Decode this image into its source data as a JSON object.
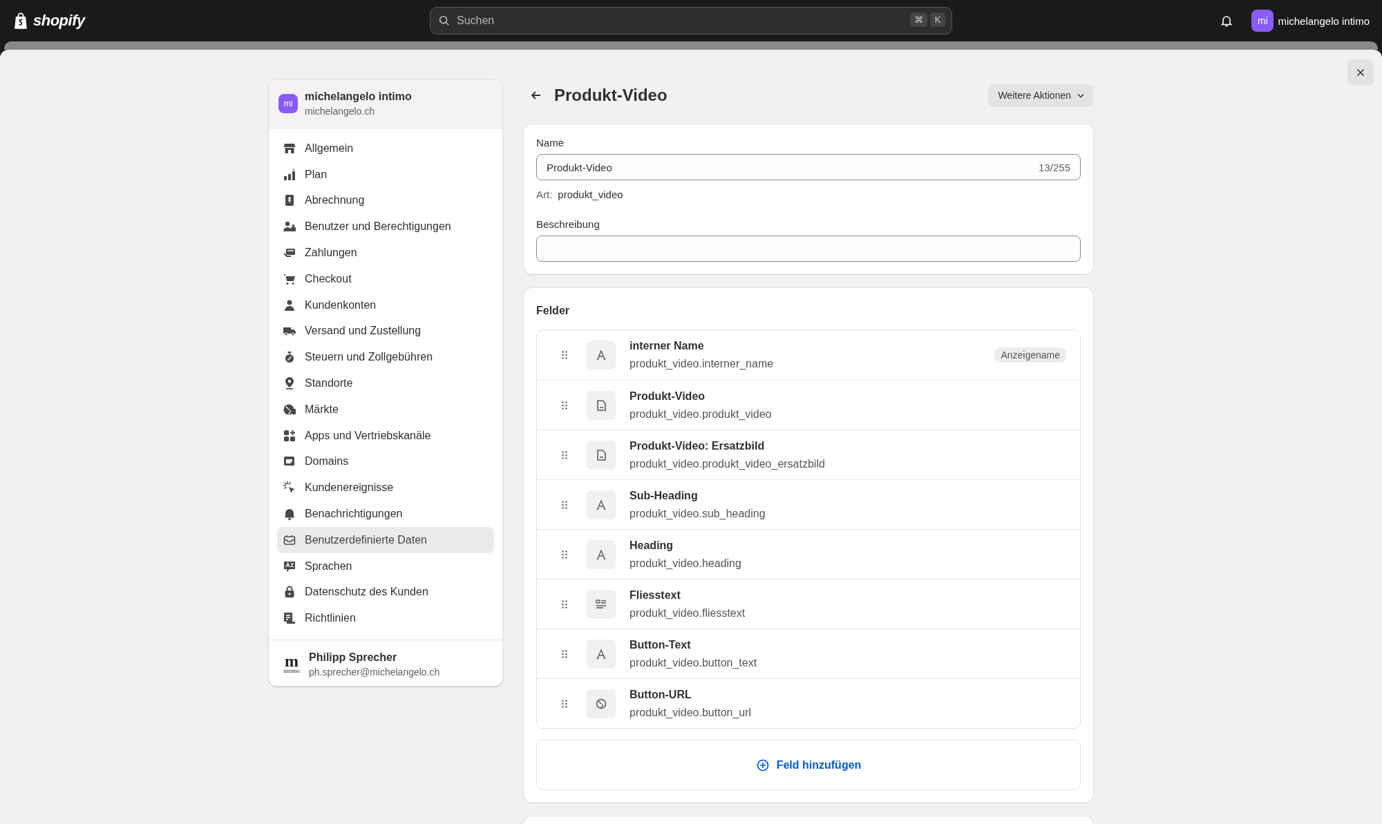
{
  "topbar": {
    "logo": "shopify",
    "search": {
      "placeholder": "Suchen",
      "shortcut": [
        "⌘",
        "K"
      ]
    },
    "account": {
      "initials": "mi",
      "name": "michelangelo intimo"
    }
  },
  "sidebar": {
    "store": {
      "initials": "mi",
      "name": "michelangelo intimo",
      "domain": "michelangelo.ch"
    },
    "items": [
      {
        "label": "Allgemein",
        "selected": false
      },
      {
        "label": "Plan",
        "selected": false
      },
      {
        "label": "Abrechnung",
        "selected": false
      },
      {
        "label": "Benutzer und Berechtigungen",
        "selected": false
      },
      {
        "label": "Zahlungen",
        "selected": false
      },
      {
        "label": "Checkout",
        "selected": false
      },
      {
        "label": "Kundenkonten",
        "selected": false
      },
      {
        "label": "Versand und Zustellung",
        "selected": false
      },
      {
        "label": "Steuern und Zollgebühren",
        "selected": false
      },
      {
        "label": "Standorte",
        "selected": false
      },
      {
        "label": "Märkte",
        "selected": false
      },
      {
        "label": "Apps und Vertriebskanäle",
        "selected": false
      },
      {
        "label": "Domains",
        "selected": false
      },
      {
        "label": "Kundenereignisse",
        "selected": false
      },
      {
        "label": "Benachrichtigungen",
        "selected": false
      },
      {
        "label": "Benutzerdefinierte Daten",
        "selected": true
      },
      {
        "label": "Sprachen",
        "selected": false
      },
      {
        "label": "Datenschutz des Kunden",
        "selected": false
      },
      {
        "label": "Richtlinien",
        "selected": false
      }
    ],
    "user": {
      "logo": "m",
      "logo_sub": "intimo",
      "name": "Philipp Sprecher",
      "email": "ph.sprecher@michelangelo.ch"
    }
  },
  "page": {
    "title": "Produkt-Video",
    "actions_button": "Weitere Aktionen"
  },
  "definition": {
    "name_label": "Name",
    "name_value": "Produkt-Video",
    "counter": "13/255",
    "type_label": "Art:",
    "type_value": "produkt_video",
    "description_label": "Beschreibung"
  },
  "fields": {
    "title": "Felder",
    "rows": [
      {
        "kind": "text",
        "name": "interner Name",
        "key": "produkt_video.interner_name",
        "badge": "Anzeigename"
      },
      {
        "kind": "file",
        "name": "Produkt-Video",
        "key": "produkt_video.produkt_video"
      },
      {
        "kind": "file",
        "name": "Produkt-Video: Ersatzbild",
        "key": "produkt_video.produkt_video_ersatzbild"
      },
      {
        "kind": "text",
        "name": "Sub-Heading",
        "key": "produkt_video.sub_heading"
      },
      {
        "kind": "text",
        "name": "Heading",
        "key": "produkt_video.heading"
      },
      {
        "kind": "richtext",
        "name": "Fliesstext",
        "key": "produkt_video.fliesstext"
      },
      {
        "kind": "text",
        "name": "Button-Text",
        "key": "produkt_video.button_text"
      },
      {
        "kind": "url",
        "name": "Button-URL",
        "key": "produkt_video.button_url"
      }
    ],
    "add_button": "Feld hinzufügen"
  }
}
